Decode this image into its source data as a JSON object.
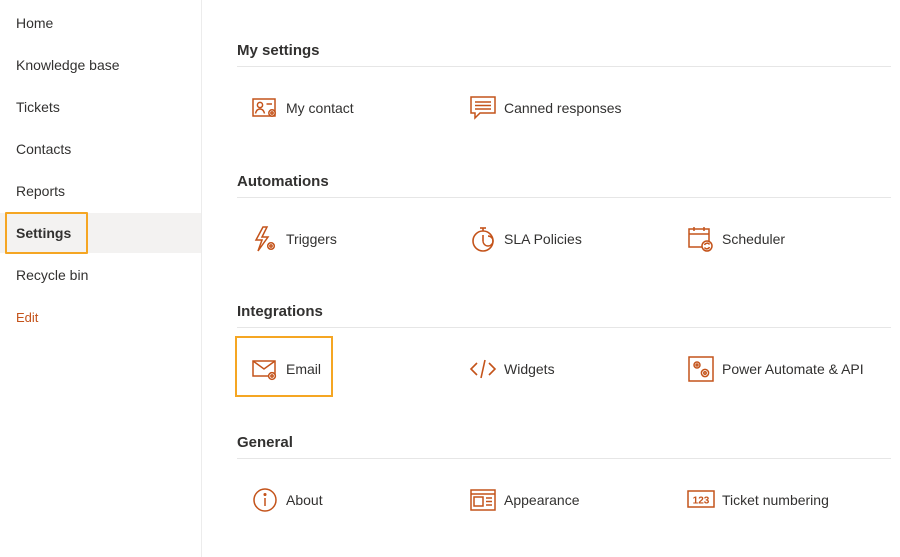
{
  "sidebar": {
    "items": [
      {
        "label": "Home"
      },
      {
        "label": "Knowledge base"
      },
      {
        "label": "Tickets"
      },
      {
        "label": "Contacts"
      },
      {
        "label": "Reports"
      },
      {
        "label": "Settings"
      },
      {
        "label": "Recycle bin"
      },
      {
        "label": "Edit"
      }
    ],
    "active": "Settings"
  },
  "sections": {
    "my_settings": {
      "title": "My settings",
      "items": [
        {
          "label": "My contact",
          "icon": "contact-card-icon"
        },
        {
          "label": "Canned responses",
          "icon": "chat-lines-icon"
        }
      ]
    },
    "automations": {
      "title": "Automations",
      "items": [
        {
          "label": "Triggers",
          "icon": "lightning-gear-icon"
        },
        {
          "label": "SLA Policies",
          "icon": "stopwatch-icon"
        },
        {
          "label": "Scheduler",
          "icon": "calendar-refresh-icon"
        }
      ]
    },
    "integrations": {
      "title": "Integrations",
      "items": [
        {
          "label": "Email",
          "icon": "envelope-gear-icon"
        },
        {
          "label": "Widgets",
          "icon": "code-brackets-icon"
        },
        {
          "label": "Power Automate & API",
          "icon": "gears-box-icon"
        }
      ]
    },
    "general": {
      "title": "General",
      "items": [
        {
          "label": "About",
          "icon": "info-circle-icon"
        },
        {
          "label": "Appearance",
          "icon": "layout-icon"
        },
        {
          "label": "Ticket numbering",
          "icon": "number-box-icon"
        }
      ]
    }
  },
  "colors": {
    "accent": "#c4531a",
    "highlight": "#f5a623",
    "active_bg": "#f3f2f1"
  }
}
